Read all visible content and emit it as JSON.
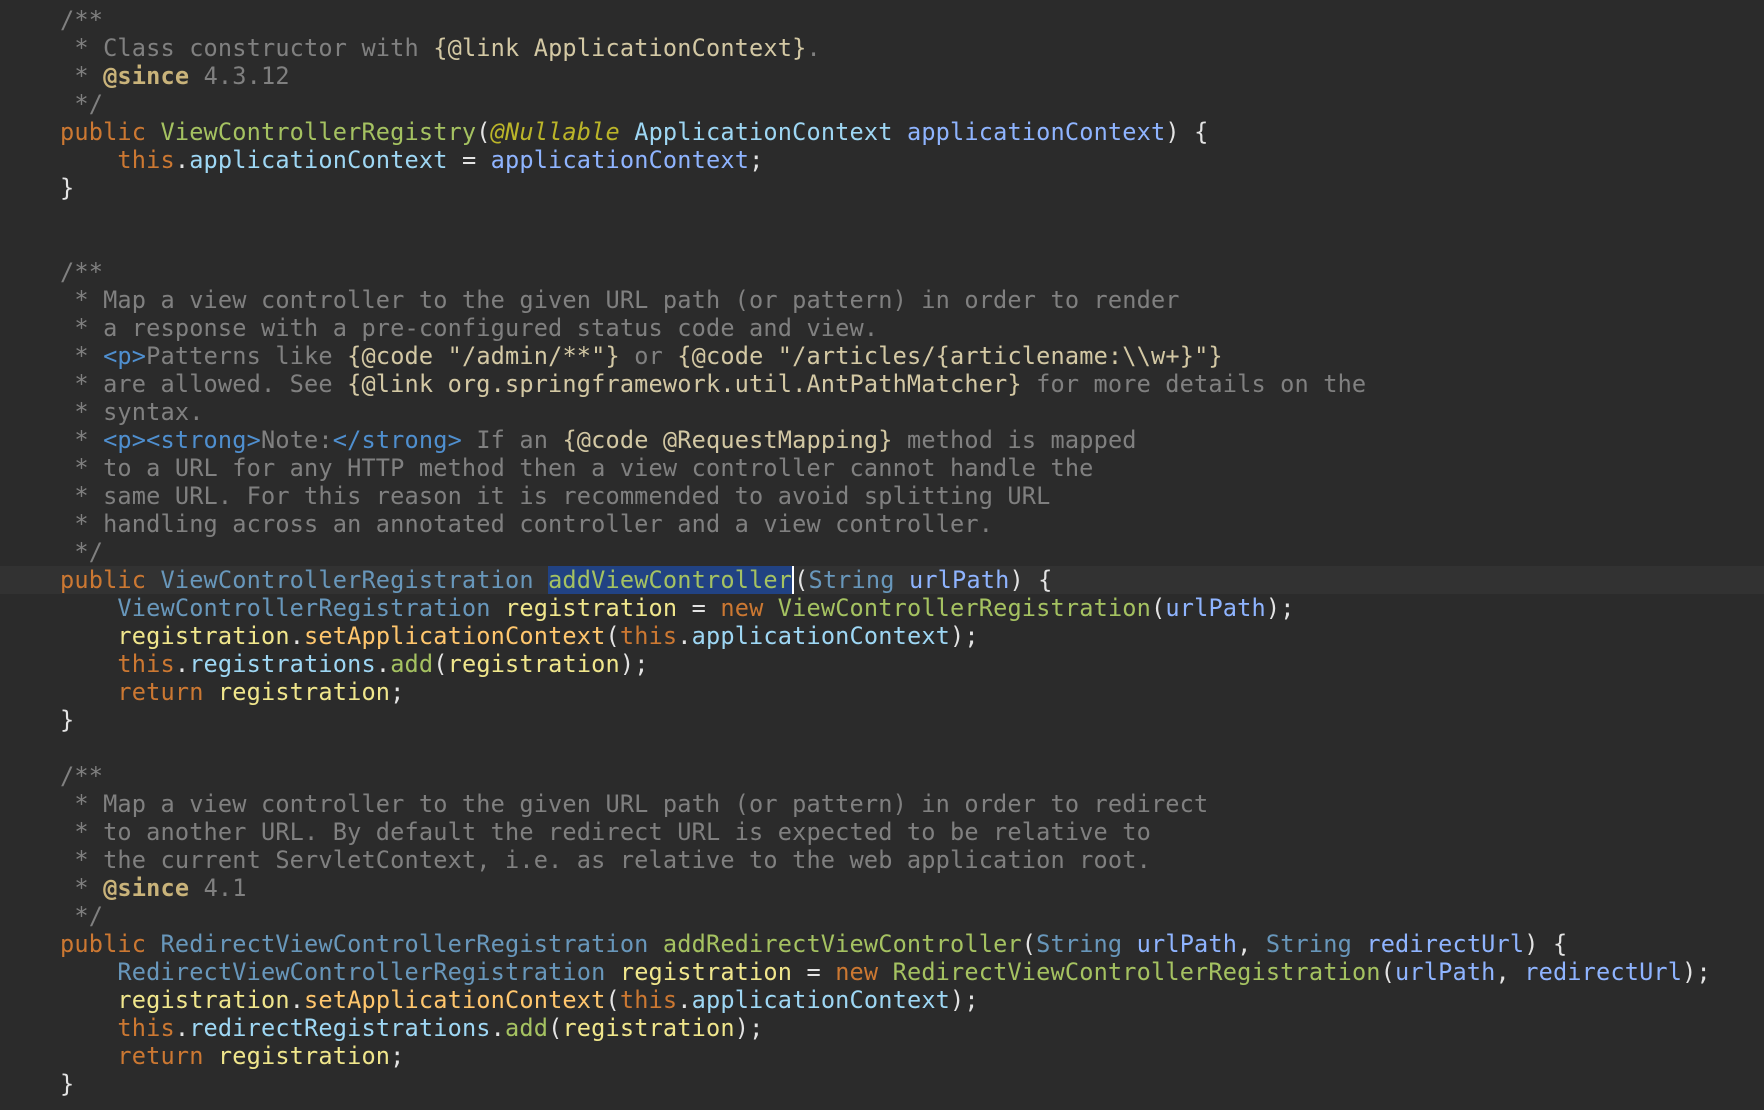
{
  "lines": [
    [
      {
        "t": "/**",
        "c": "cm"
      }
    ],
    [
      {
        "t": " * Class constructor with ",
        "c": "cm"
      },
      {
        "t": "{@link ApplicationContext}",
        "c": "link"
      },
      {
        "t": ".",
        "c": "cm"
      }
    ],
    [
      {
        "t": " * ",
        "c": "cm"
      },
      {
        "t": "@since",
        "c": "doctag"
      },
      {
        "t": " 4.3.12",
        "c": "cm"
      }
    ],
    [
      {
        "t": " */",
        "c": "cm"
      }
    ],
    [
      {
        "t": "public ",
        "c": "kw"
      },
      {
        "t": "ViewControllerRegistry",
        "c": "ctor"
      },
      {
        "t": "(",
        "c": "pl"
      },
      {
        "t": "@Nullable",
        "c": "ann"
      },
      {
        "t": " ",
        "c": "pl"
      },
      {
        "t": "ApplicationContext",
        "c": "fld"
      },
      {
        "t": " ",
        "c": "pl"
      },
      {
        "t": "applicationContext",
        "c": "param"
      },
      {
        "t": ") {",
        "c": "pl"
      }
    ],
    [
      {
        "t": "    ",
        "c": "pl"
      },
      {
        "t": "this",
        "c": "kw"
      },
      {
        "t": ".",
        "c": "pl"
      },
      {
        "t": "applicationContext",
        "c": "fld"
      },
      {
        "t": " = ",
        "c": "pl"
      },
      {
        "t": "applicationContext",
        "c": "param"
      },
      {
        "t": ";",
        "c": "pl"
      }
    ],
    [
      {
        "t": "}",
        "c": "pl"
      }
    ],
    [],
    [],
    [
      {
        "t": "/**",
        "c": "cm"
      }
    ],
    [
      {
        "t": " * Map a view controller to the given URL path (or pattern) in order to render",
        "c": "cm"
      }
    ],
    [
      {
        "t": " * a response with a pre-configured status code and view.",
        "c": "cm"
      }
    ],
    [
      {
        "t": " * ",
        "c": "cm"
      },
      {
        "t": "<p>",
        "c": "tag"
      },
      {
        "t": "Patterns like ",
        "c": "cm"
      },
      {
        "t": "{@code \"/admin/**\"}",
        "c": "link"
      },
      {
        "t": " or ",
        "c": "cm"
      },
      {
        "t": "{@code \"/articles/{articlename:\\\\w+}\"}",
        "c": "link"
      }
    ],
    [
      {
        "t": " * are allowed. See ",
        "c": "cm"
      },
      {
        "t": "{@link org.springframework.util.AntPathMatcher}",
        "c": "link"
      },
      {
        "t": " for more details on the",
        "c": "cm"
      }
    ],
    [
      {
        "t": " * syntax.",
        "c": "cm"
      }
    ],
    [
      {
        "t": " * ",
        "c": "cm"
      },
      {
        "t": "<p><strong>",
        "c": "tag"
      },
      {
        "t": "Note:",
        "c": "cm"
      },
      {
        "t": "</strong>",
        "c": "tag"
      },
      {
        "t": " If an ",
        "c": "cm"
      },
      {
        "t": "{@code @RequestMapping}",
        "c": "link"
      },
      {
        "t": " method is mapped",
        "c": "cm"
      }
    ],
    [
      {
        "t": " * to a URL for any HTTP method then a view controller cannot handle the",
        "c": "cm"
      }
    ],
    [
      {
        "t": " * same URL. For this reason it is recommended to avoid splitting URL",
        "c": "cm"
      }
    ],
    [
      {
        "t": " * handling across an annotated controller and a view controller.",
        "c": "cm"
      }
    ],
    [
      {
        "t": " */",
        "c": "cm"
      }
    ],
    [
      {
        "t": "public ",
        "c": "kw"
      },
      {
        "t": "ViewControllerRegistration",
        "c": "cls"
      },
      {
        "t": " ",
        "c": "pl"
      },
      {
        "t": "addViewController",
        "c": "ctor",
        "sel": true
      },
      {
        "t": "(",
        "c": "pl"
      },
      {
        "t": "String",
        "c": "cls"
      },
      {
        "t": " ",
        "c": "pl"
      },
      {
        "t": "urlPath",
        "c": "param"
      },
      {
        "t": ") {",
        "c": "pl"
      }
    ],
    [
      {
        "t": "    ",
        "c": "pl"
      },
      {
        "t": "ViewControllerRegistration",
        "c": "cls"
      },
      {
        "t": " ",
        "c": "pl"
      },
      {
        "t": "registration",
        "c": "var"
      },
      {
        "t": " = ",
        "c": "pl"
      },
      {
        "t": "new ",
        "c": "kw"
      },
      {
        "t": "ViewControllerRegistration",
        "c": "ctor"
      },
      {
        "t": "(",
        "c": "pl"
      },
      {
        "t": "urlPath",
        "c": "param"
      },
      {
        "t": ");",
        "c": "pl"
      }
    ],
    [
      {
        "t": "    ",
        "c": "pl"
      },
      {
        "t": "registration",
        "c": "var"
      },
      {
        "t": ".",
        "c": "pl"
      },
      {
        "t": "setApplicationContext",
        "c": "fn"
      },
      {
        "t": "(",
        "c": "pl"
      },
      {
        "t": "this",
        "c": "kw"
      },
      {
        "t": ".",
        "c": "pl"
      },
      {
        "t": "applicationContext",
        "c": "fld"
      },
      {
        "t": ");",
        "c": "pl"
      }
    ],
    [
      {
        "t": "    ",
        "c": "pl"
      },
      {
        "t": "this",
        "c": "kw"
      },
      {
        "t": ".",
        "c": "pl"
      },
      {
        "t": "registrations",
        "c": "fld"
      },
      {
        "t": ".",
        "c": "pl"
      },
      {
        "t": "add",
        "c": "ctor"
      },
      {
        "t": "(",
        "c": "pl"
      },
      {
        "t": "registration",
        "c": "var"
      },
      {
        "t": ");",
        "c": "pl"
      }
    ],
    [
      {
        "t": "    ",
        "c": "pl"
      },
      {
        "t": "return ",
        "c": "kw"
      },
      {
        "t": "registration",
        "c": "var"
      },
      {
        "t": ";",
        "c": "pl"
      }
    ],
    [
      {
        "t": "}",
        "c": "pl"
      }
    ],
    [],
    [
      {
        "t": "/**",
        "c": "cm"
      }
    ],
    [
      {
        "t": " * Map a view controller to the given URL path (or pattern) in order to redirect",
        "c": "cm"
      }
    ],
    [
      {
        "t": " * to another URL. By default the redirect URL is expected to be relative to",
        "c": "cm"
      }
    ],
    [
      {
        "t": " * the current ServletContext, i.e. as relative to the web application root.",
        "c": "cm"
      }
    ],
    [
      {
        "t": " * ",
        "c": "cm"
      },
      {
        "t": "@since",
        "c": "doctag"
      },
      {
        "t": " 4.1",
        "c": "cm"
      }
    ],
    [
      {
        "t": " */",
        "c": "cm"
      }
    ],
    [
      {
        "t": "public ",
        "c": "kw"
      },
      {
        "t": "RedirectViewControllerRegistration",
        "c": "cls"
      },
      {
        "t": " ",
        "c": "pl"
      },
      {
        "t": "addRedirectViewController",
        "c": "ctor"
      },
      {
        "t": "(",
        "c": "pl"
      },
      {
        "t": "String",
        "c": "cls"
      },
      {
        "t": " ",
        "c": "pl"
      },
      {
        "t": "urlPath",
        "c": "param"
      },
      {
        "t": ", ",
        "c": "pl"
      },
      {
        "t": "String",
        "c": "cls"
      },
      {
        "t": " ",
        "c": "pl"
      },
      {
        "t": "redirectUrl",
        "c": "param"
      },
      {
        "t": ") {",
        "c": "pl"
      }
    ],
    [
      {
        "t": "    ",
        "c": "pl"
      },
      {
        "t": "RedirectViewControllerRegistration",
        "c": "cls"
      },
      {
        "t": " ",
        "c": "pl"
      },
      {
        "t": "registration",
        "c": "var"
      },
      {
        "t": " = ",
        "c": "pl"
      },
      {
        "t": "new ",
        "c": "kw"
      },
      {
        "t": "RedirectViewControllerRegistration",
        "c": "ctor"
      },
      {
        "t": "(",
        "c": "pl"
      },
      {
        "t": "urlPath",
        "c": "param"
      },
      {
        "t": ", ",
        "c": "pl"
      },
      {
        "t": "redirectUrl",
        "c": "param"
      },
      {
        "t": ");",
        "c": "pl"
      }
    ],
    [
      {
        "t": "    ",
        "c": "pl"
      },
      {
        "t": "registration",
        "c": "var"
      },
      {
        "t": ".",
        "c": "pl"
      },
      {
        "t": "setApplicationContext",
        "c": "fn"
      },
      {
        "t": "(",
        "c": "pl"
      },
      {
        "t": "this",
        "c": "kw"
      },
      {
        "t": ".",
        "c": "pl"
      },
      {
        "t": "applicationContext",
        "c": "fld"
      },
      {
        "t": ");",
        "c": "pl"
      }
    ],
    [
      {
        "t": "    ",
        "c": "pl"
      },
      {
        "t": "this",
        "c": "kw"
      },
      {
        "t": ".",
        "c": "pl"
      },
      {
        "t": "redirectRegistrations",
        "c": "fld"
      },
      {
        "t": ".",
        "c": "pl"
      },
      {
        "t": "add",
        "c": "ctor"
      },
      {
        "t": "(",
        "c": "pl"
      },
      {
        "t": "registration",
        "c": "var"
      },
      {
        "t": ");",
        "c": "pl"
      }
    ],
    [
      {
        "t": "    ",
        "c": "pl"
      },
      {
        "t": "return ",
        "c": "kw"
      },
      {
        "t": "registration",
        "c": "var"
      },
      {
        "t": ";",
        "c": "pl"
      }
    ],
    [
      {
        "t": "}",
        "c": "pl"
      }
    ]
  ],
  "current_line": 20,
  "colors": {
    "background": "#2b2b2b",
    "current_line": "#323232",
    "selection": "#214283",
    "keyword": "#cc7832",
    "comment": "#808080"
  }
}
